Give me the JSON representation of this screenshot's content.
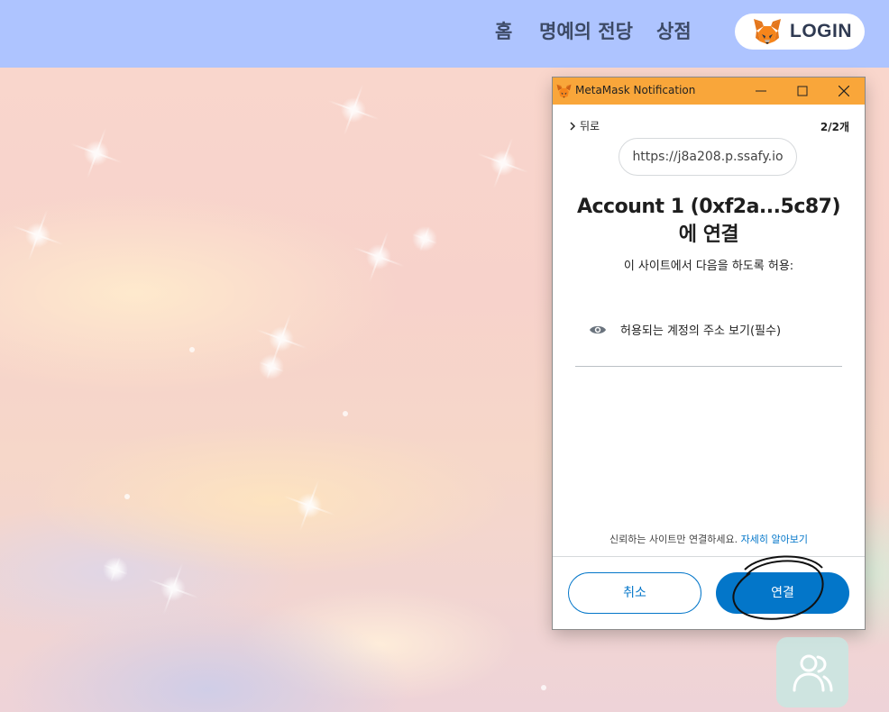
{
  "header": {
    "nav": [
      {
        "label": "홈"
      },
      {
        "label": "명예의 전당"
      },
      {
        "label": "상점"
      }
    ],
    "login_label": "LOGIN",
    "login_icon": "metamask-fox-icon",
    "background_color": "#aec4ff"
  },
  "metamask": {
    "window_title": "MetaMask Notification",
    "titlebar_color": "#f9a63a",
    "back_label": "뒤로",
    "page_count": "2/2개",
    "site_url": "https://j8a208.p.ssafy.io",
    "heading_line1": "Account 1 (0xf2a...5c87)",
    "heading_line2": "에 연결",
    "subheading": "이 사이트에서 다음을 하도록 허용:",
    "permission": {
      "icon": "eye-icon",
      "text": "허용되는 계정의 주소 보기(필수)"
    },
    "trust_notice": "신뢰하는 사이트만 연결하세요.",
    "learn_more_link": "자세히 알아보기",
    "cancel_label": "취소",
    "connect_label": "연결",
    "accent_color": "#0376c9"
  },
  "friends_button": {
    "icon": "people-icon"
  }
}
